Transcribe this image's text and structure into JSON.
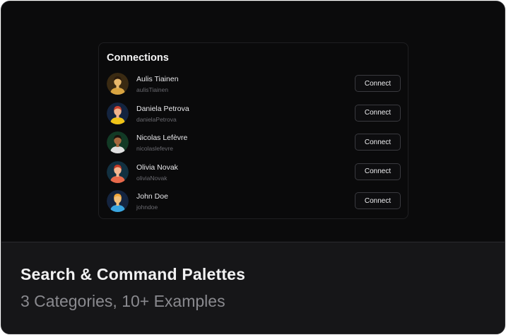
{
  "connections": {
    "title": "Connections",
    "button_label": "Connect",
    "people": [
      {
        "name": "Aulis Tiainen",
        "handle": "aulisTiainen",
        "avatar_bg": "#3a2a12",
        "skin": "#e8b86a",
        "hair": "#2a1a0c",
        "shirt": "#d9a441"
      },
      {
        "name": "Daniela Petrova",
        "handle": "danielaPetrova",
        "avatar_bg": "#14243f",
        "skin": "#f0b48c",
        "hair": "#c8402e",
        "shirt": "#f0c418"
      },
      {
        "name": "Nicolas Lefèvre",
        "handle": "nicolaslefevre",
        "avatar_bg": "#123a25",
        "skin": "#a4683e",
        "hair": "#1a120c",
        "shirt": "#e0e0e0"
      },
      {
        "name": "Olivia Novak",
        "handle": "oliviaNovak",
        "avatar_bg": "#123040",
        "skin": "#f4b690",
        "hair": "#c23a26",
        "shirt": "#e8694a"
      },
      {
        "name": "John Doe",
        "handle": "johndoe",
        "avatar_bg": "#14243f",
        "skin": "#f2c07a",
        "hair": "#f0a63a",
        "shirt": "#3aa6e0"
      }
    ]
  },
  "footer": {
    "title": "Search & Command Palettes",
    "subtitle": "3 Categories, 10+ Examples"
  }
}
